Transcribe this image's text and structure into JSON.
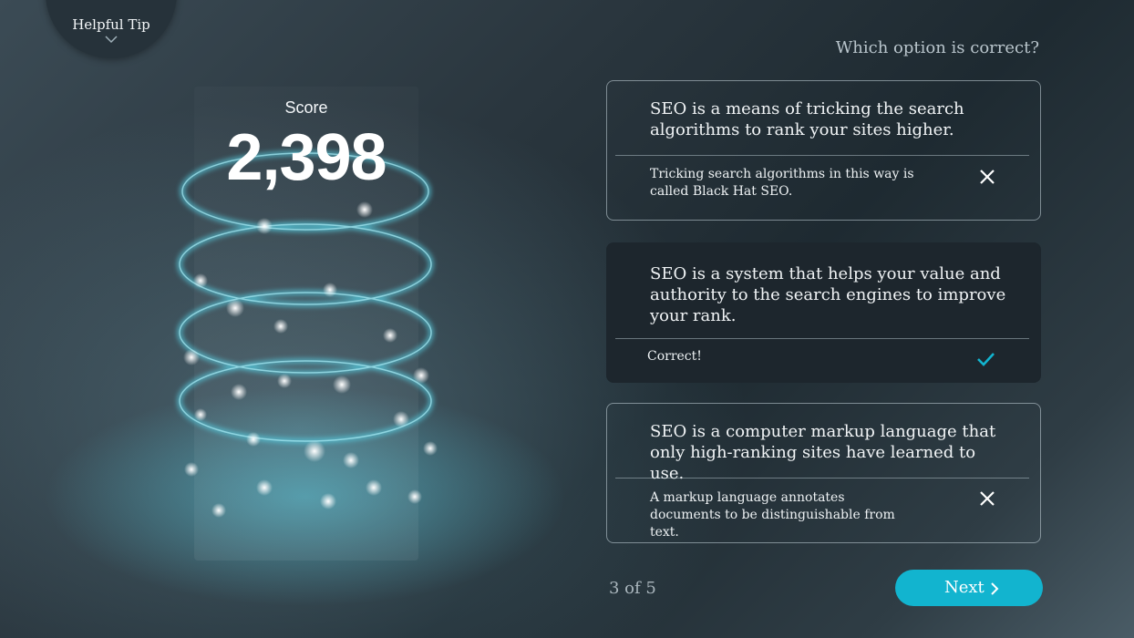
{
  "tip": {
    "label": "Helpful Tip",
    "icon": "chevron-down-icon"
  },
  "score": {
    "label": "Score",
    "value": "2,398"
  },
  "question": "Which option is correct?",
  "options": [
    {
      "text": "SEO is a means of tricking the search algorithms to rank your sites higher.",
      "feedback": "Tricking search algorithms in this way is called Black Hat SEO.",
      "status": "incorrect",
      "icon": "close-icon"
    },
    {
      "text": "SEO is a system that helps your value and authority to the search engines to improve your rank.",
      "feedback": "Correct!",
      "status": "correct",
      "icon": "check-icon"
    },
    {
      "text": "SEO is a computer markup language that only high-ranking sites have learned to use.",
      "feedback": "A markup language annotates documents to be distinguishable from text.",
      "status": "incorrect",
      "icon": "close-icon"
    }
  ],
  "progress": "3 of 5",
  "next": {
    "label": "Next",
    "icon": "chevron-right-icon"
  },
  "colors": {
    "accent": "#12b4cf",
    "correct_bg": "#1d262d",
    "glow": "#5acde1"
  }
}
